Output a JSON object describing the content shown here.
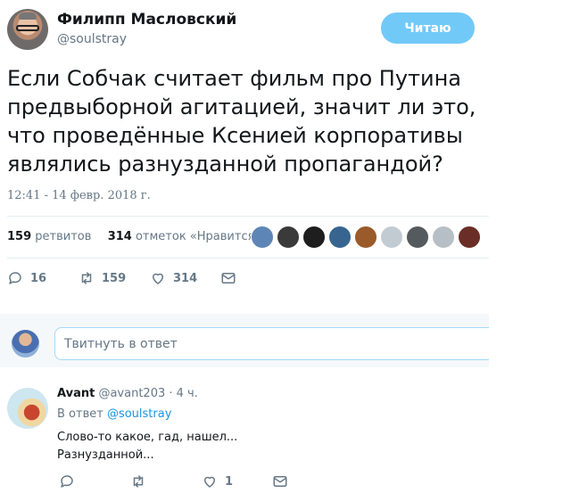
{
  "tweet": {
    "author_name": "Филипп Масловский",
    "author_handle": "@soulstray",
    "follow_label": "Читаю",
    "text": "Если Собчак считает фильм про Путина предвыборной агитацией, значит ли это, что проведённые Ксенией корпоративы являлись разнузданной пропагандой?",
    "timestamp": "12:41 - 14 февр. 2018 г.",
    "retweets_count": "159",
    "retweets_label": "ретвитов",
    "likes_count": "314",
    "likes_label": "отметок «Нравится»",
    "actions": {
      "reply_count": "16",
      "retweet_count": "159",
      "like_count": "314"
    }
  },
  "reply_box": {
    "placeholder": "Твитнуть в ответ"
  },
  "reply": {
    "author_name": "Avant",
    "author_handle": "@avant203",
    "time": "· 4 ч.",
    "reply_to_prefix": "В ответ",
    "reply_to_handle": "@soulstray",
    "text_line1": "Слово-то какое, гад, нашел...",
    "text_line2": "Разнузданной...",
    "actions": {
      "like_count": "1"
    }
  },
  "colors": {
    "accent": "#1b95e0",
    "follow_bg": "#71c9f8",
    "muted": "#657786"
  }
}
